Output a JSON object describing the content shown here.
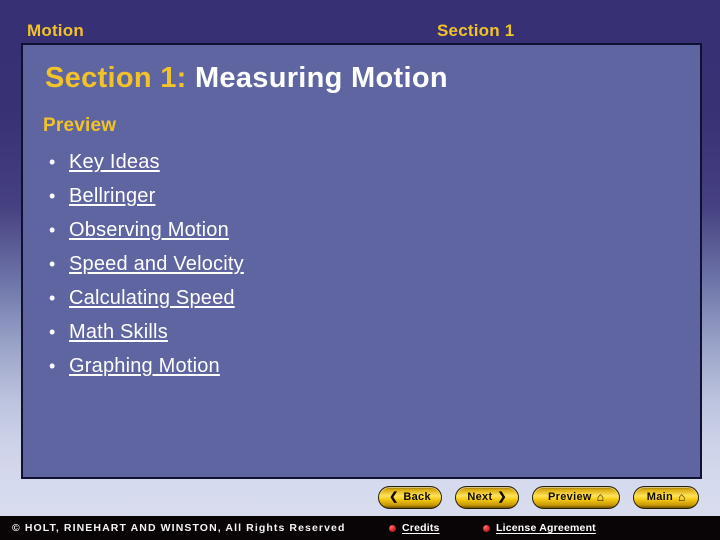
{
  "header": {
    "left_label": "Motion",
    "right_label": "Section 1"
  },
  "slide": {
    "title_accent": "Section 1:",
    "title_rest": " Measuring Motion",
    "preview_label": "Preview",
    "bullet_glyph": "•",
    "links": [
      {
        "label": "Key Ideas"
      },
      {
        "label": "Bellringer"
      },
      {
        "label": "Observing Motion"
      },
      {
        "label": "Speed and Velocity"
      },
      {
        "label": "Calculating Speed"
      },
      {
        "label": "Math Skills"
      },
      {
        "label": "Graphing Motion"
      }
    ]
  },
  "nav": {
    "back": {
      "label": "Back",
      "glyph": "❮",
      "icon": "chevron-left-icon"
    },
    "next": {
      "label": "Next",
      "glyph": "❯",
      "icon": "chevron-right-icon"
    },
    "preview": {
      "label": "Preview",
      "glyph": "⌂",
      "icon": "home-icon"
    },
    "main": {
      "label": "Main",
      "glyph": "⌂",
      "icon": "home-icon"
    }
  },
  "footer": {
    "copyright": "© HOLT, RINEHART AND WINSTON, All Rights Reserved",
    "credits_label": "Credits",
    "license_label": "License Agreement"
  },
  "colors": {
    "background_top": "#373074",
    "background_bottom": "#d6daee",
    "panel_fill": "#5f65a0",
    "panel_border": "#101033",
    "accent_gold": "#f2c229",
    "link_white": "#ffffff",
    "button_gold": "#f6cc14",
    "footer_bar": "#090406",
    "footer_dot_red": "#d2262b"
  }
}
